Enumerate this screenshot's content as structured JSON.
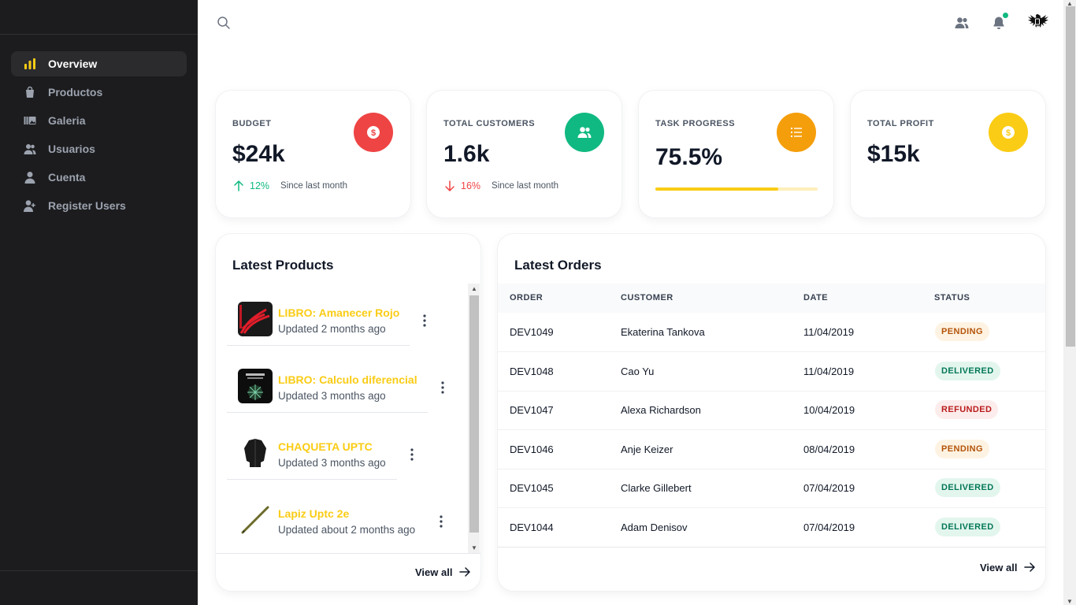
{
  "sidebar": {
    "items": [
      {
        "label": "Overview",
        "icon": "bar-chart-icon",
        "active": true
      },
      {
        "label": "Productos",
        "icon": "shopping-bag-icon",
        "active": false
      },
      {
        "label": "Galeria",
        "icon": "gallery-icon",
        "active": false
      },
      {
        "label": "Usuarios",
        "icon": "users-icon",
        "active": false
      },
      {
        "label": "Cuenta",
        "icon": "user-icon",
        "active": false
      },
      {
        "label": "Register Users",
        "icon": "user-plus-icon",
        "active": false
      }
    ]
  },
  "topbar": {
    "icons": [
      "search-icon",
      "users-icon",
      "bell-icon"
    ],
    "notification_dot": true,
    "avatar": "eagle-crest-avatar"
  },
  "stats": [
    {
      "label": "BUDGET",
      "value": "$24k",
      "trend_pct": "12%",
      "trend_dir": "up",
      "trend_text": "Since last month",
      "icon": "dollar-icon",
      "color": "#ef4444"
    },
    {
      "label": "TOTAL CUSTOMERS",
      "value": "1.6k",
      "trend_pct": "16%",
      "trend_dir": "down",
      "trend_text": "Since last month",
      "icon": "users-icon",
      "color": "#10b981"
    },
    {
      "label": "TASK PROGRESS",
      "value": "75.5%",
      "progress": 0.755,
      "icon": "list-icon",
      "color": "#f59e0b"
    },
    {
      "label": "TOTAL PROFIT",
      "value": "$15k",
      "icon": "dollar-icon",
      "color": "#facc15"
    }
  ],
  "products": {
    "title": "Latest Products",
    "items": [
      {
        "name": "LIBRO: Amanecer Rojo",
        "updated": "Updated 2 months ago"
      },
      {
        "name": "LIBRO: Calculo diferencial",
        "updated": "Updated 3 months ago"
      },
      {
        "name": "CHAQUETA UPTC",
        "updated": "Updated 3 months ago"
      },
      {
        "name": "Lapiz Uptc 2e",
        "updated": "Updated about 2 months ago"
      }
    ],
    "view_all": "View all"
  },
  "orders": {
    "title": "Latest Orders",
    "columns": [
      "ORDER",
      "CUSTOMER",
      "DATE",
      "STATUS"
    ],
    "rows": [
      {
        "order": "DEV1049",
        "customer": "Ekaterina Tankova",
        "date": "11/04/2019",
        "status": "PENDING"
      },
      {
        "order": "DEV1048",
        "customer": "Cao Yu",
        "date": "11/04/2019",
        "status": "DELIVERED"
      },
      {
        "order": "DEV1047",
        "customer": "Alexa Richardson",
        "date": "10/04/2019",
        "status": "REFUNDED"
      },
      {
        "order": "DEV1046",
        "customer": "Anje Keizer",
        "date": "08/04/2019",
        "status": "PENDING"
      },
      {
        "order": "DEV1045",
        "customer": "Clarke Gillebert",
        "date": "07/04/2019",
        "status": "DELIVERED"
      },
      {
        "order": "DEV1044",
        "customer": "Adam Denisov",
        "date": "07/04/2019",
        "status": "DELIVERED"
      }
    ],
    "view_all": "View all"
  },
  "colors": {
    "sidebar_bg": "#1c1c1e",
    "accent_yellow": "#facc15",
    "up": "#10b981",
    "down": "#ef4444"
  }
}
